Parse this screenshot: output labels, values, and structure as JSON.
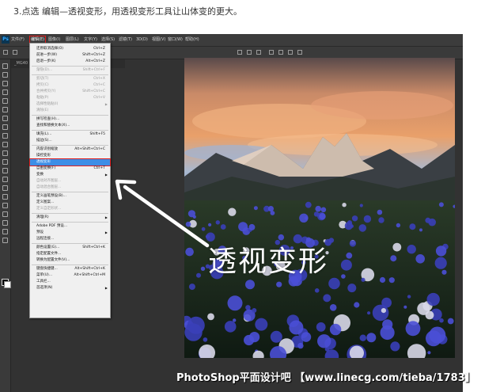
{
  "caption": "3.点选 编辑—透视变形，用透视变形工具让山体变的更大。",
  "app": {
    "logo": "Ps",
    "menubar": [
      "文件(F)",
      "编辑(E)",
      "图像(I)",
      "图层(L)",
      "文字(Y)",
      "选择(S)",
      "滤镜(T)",
      "3D(D)",
      "视图(V)",
      "窗口(W)",
      "帮助(H)"
    ],
    "active_menu_index": 1,
    "doc_tab": "_MG40"
  },
  "edit_menu": [
    {
      "label": "还原取消选择(O)",
      "shortcut": "Ctrl+Z"
    },
    {
      "label": "前进一步(W)",
      "shortcut": "Shift+Ctrl+Z"
    },
    {
      "label": "后退一步(K)",
      "shortcut": "Alt+Ctrl+Z"
    },
    {
      "sep": true
    },
    {
      "label": "渐隐(D)...",
      "shortcut": "Shift+Ctrl+F",
      "disabled": true
    },
    {
      "sep": true
    },
    {
      "label": "剪切(T)",
      "shortcut": "Ctrl+X",
      "disabled": true
    },
    {
      "label": "拷贝(C)",
      "shortcut": "Ctrl+C",
      "disabled": true
    },
    {
      "label": "合并拷贝(Y)",
      "shortcut": "Shift+Ctrl+C",
      "disabled": true
    },
    {
      "label": "粘贴(P)",
      "shortcut": "Ctrl+V",
      "disabled": true
    },
    {
      "label": "选择性粘贴(I)",
      "disabled": true,
      "submenu": true
    },
    {
      "label": "清除(E)",
      "disabled": true
    },
    {
      "sep": true
    },
    {
      "label": "拼写检查(H)..."
    },
    {
      "label": "查找和替换文本(X)..."
    },
    {
      "sep": true
    },
    {
      "label": "填充(L)...",
      "shortcut": "Shift+F5"
    },
    {
      "label": "描边(S)..."
    },
    {
      "sep": true
    },
    {
      "label": "内容识别缩放",
      "shortcut": "Alt+Shift+Ctrl+C"
    },
    {
      "label": "操控变形"
    },
    {
      "label": "透视变形",
      "highlight": true
    },
    {
      "label": "自由变换(F)",
      "shortcut": "Ctrl+T"
    },
    {
      "label": "变换",
      "submenu": true
    },
    {
      "label": "自动对齐图层...",
      "disabled": true
    },
    {
      "label": "自动混合图层...",
      "disabled": true
    },
    {
      "sep": true
    },
    {
      "label": "定义画笔预设(B)..."
    },
    {
      "label": "定义图案..."
    },
    {
      "label": "定义自定形状...",
      "disabled": true
    },
    {
      "sep": true
    },
    {
      "label": "清理(R)",
      "submenu": true
    },
    {
      "sep": true
    },
    {
      "label": "Adobe PDF 预设..."
    },
    {
      "label": "预设",
      "submenu": true
    },
    {
      "label": "远程连接..."
    },
    {
      "sep": true
    },
    {
      "label": "颜色设置(G)...",
      "shortcut": "Shift+Ctrl+K"
    },
    {
      "label": "指定配置文件..."
    },
    {
      "label": "转换为配置文件(V)..."
    },
    {
      "sep": true
    },
    {
      "label": "键盘快捷键...",
      "shortcut": "Alt+Shift+Ctrl+K"
    },
    {
      "label": "菜单(U)...",
      "shortcut": "Alt+Shift+Ctrl+M"
    },
    {
      "label": "工具栏..."
    },
    {
      "label": "首选项(N)",
      "submenu": true
    }
  ],
  "overlay_text": "透视变形",
  "watermark": "PhotoShop平面设计吧 【www.linecg.com/tieba/1783】",
  "colors": {
    "highlight": "#3d8ee6",
    "annotation_red": "#e02020",
    "flowers": "#4a4fd6",
    "sky_glow": "#e9a06a"
  }
}
